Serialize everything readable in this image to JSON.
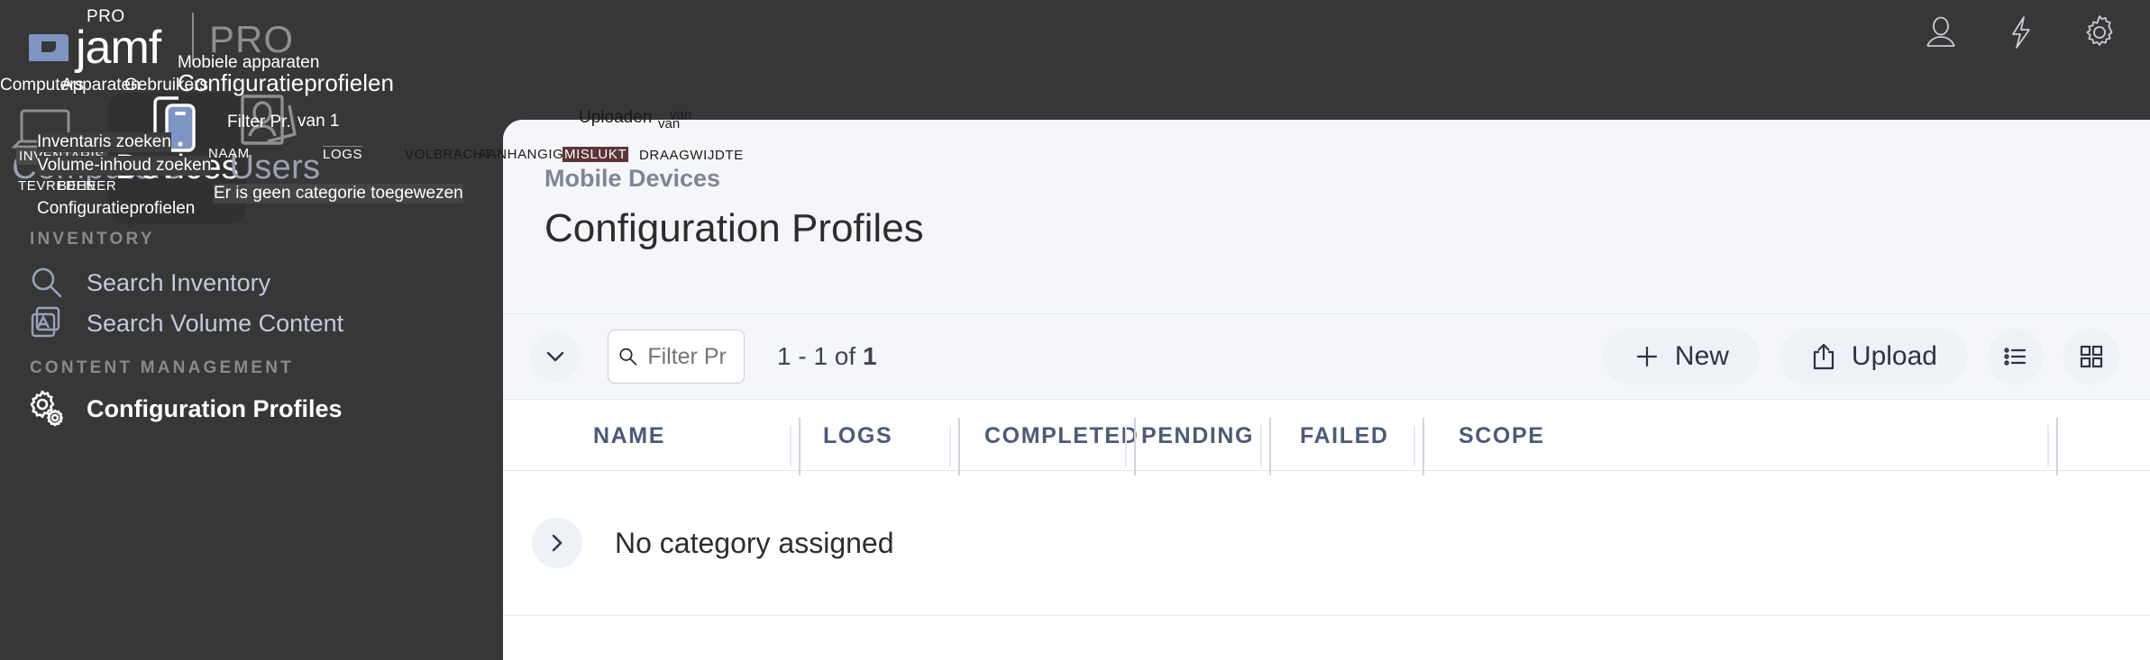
{
  "app": {
    "brand_word": "jamf",
    "brand_sup": "PRO",
    "brand_divider_text": "PRO",
    "logo_accent": "#7e95c4",
    "chrome_bg": "#373737",
    "panel_bg": "#f4f6f9"
  },
  "topbar": {
    "icons": [
      {
        "name": "user-icon",
        "label": "User"
      },
      {
        "name": "bolt-icon",
        "label": "Quick actions"
      },
      {
        "name": "gear-icon",
        "label": "Settings"
      }
    ]
  },
  "tiles": [
    {
      "name": "Computers",
      "selected": false
    },
    {
      "name": "Devices",
      "selected": true
    },
    {
      "name": "Users",
      "selected": false
    }
  ],
  "sidebar": {
    "sections": [
      {
        "label": "INVENTORY",
        "items": [
          {
            "label": "Search Inventory",
            "icon": "search-icon",
            "active": false
          },
          {
            "label": "Search Volume Content",
            "icon": "app-store-icon",
            "active": false
          }
        ]
      },
      {
        "label": "CONTENT MANAGEMENT",
        "items": [
          {
            "label": "Configuration Profiles",
            "icon": "gears-icon",
            "active": true
          }
        ]
      }
    ]
  },
  "main": {
    "breadcrumb": "Mobile Devices",
    "title": "Configuration Profiles",
    "toolbar": {
      "collapse_icon": "chevron-down-icon",
      "filter_placeholder": "Filter Pr",
      "filter_value": "",
      "search_icon": "search-icon",
      "count_prefix": "1 - 1 of ",
      "count_total": "1",
      "new_label": "New",
      "new_icon": "plus-icon",
      "upload_label": "Upload",
      "upload_icon": "upload-icon",
      "list_view_icon": "list-view-icon",
      "grid_view_icon": "grid-view-icon"
    },
    "table": {
      "columns": [
        "NAME",
        "LOGS",
        "COMPLETED",
        "PENDING",
        "FAILED",
        "SCOPE"
      ],
      "rows": [
        {
          "expand_icon": "chevron-right-icon",
          "label": "No category assigned"
        }
      ]
    }
  },
  "annotations": {
    "nav_row": [
      "Computers",
      "Apparaten",
      "Gebruikers"
    ],
    "mobile_devices": "Mobiele apparaten",
    "config_profiles_title": "Configuratieprofielen",
    "inventory_badge": "INVENTARIS",
    "search_inventory": "Inventaris zoeken",
    "volume_content": "Volume-inhoud zoeken",
    "satisfied": "TEVREDEN",
    "management": "BEHEER",
    "config_profiles_side": "Configuratieprofielen",
    "filter_pr": "Filter Pr.",
    "of_one": "van 1",
    "name_col": "NAAM",
    "logs_col": "LOGS",
    "no_category": "Er is geen categorie toegewezen",
    "upload": "Uploaden",
    "of_a": "van",
    "of_b": "van",
    "completed": "VOLBRACHT",
    "pending": "AANHANGIG",
    "failed": "MISLUKT",
    "scope": "DRAAGWIJDTE"
  }
}
